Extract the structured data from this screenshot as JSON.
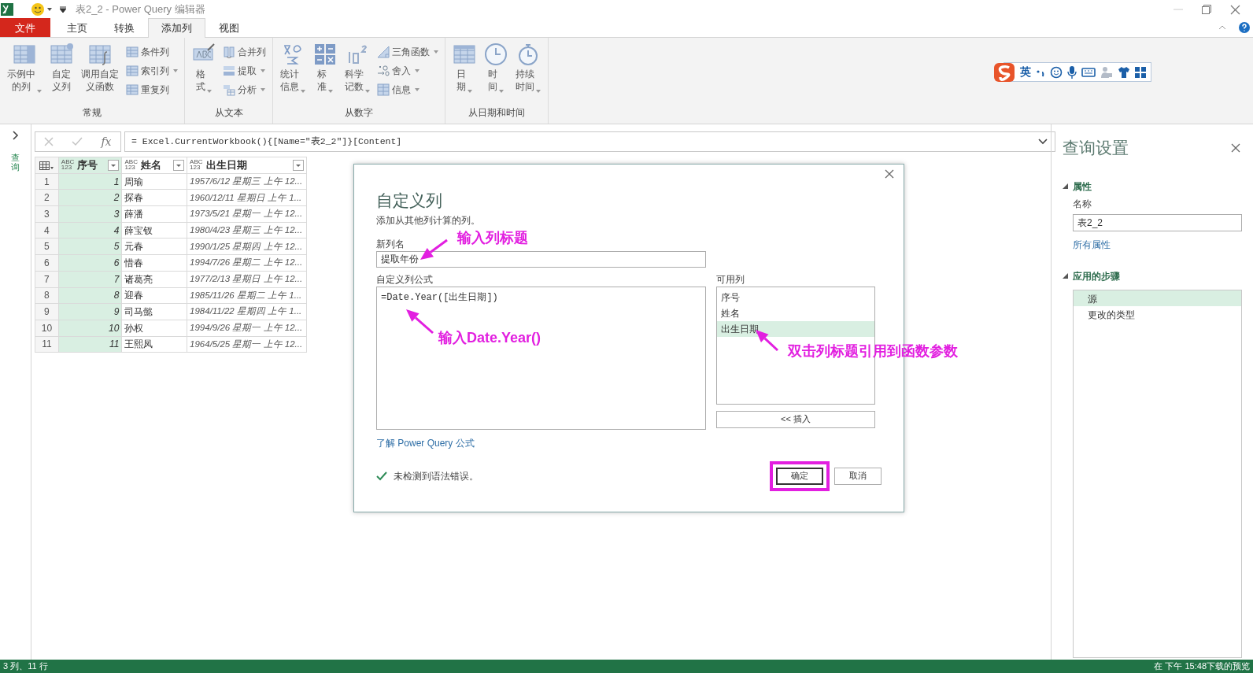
{
  "window": {
    "title": "表2_2 - Power Query 编辑器"
  },
  "menu_tabs": [
    {
      "label": "文件",
      "kind": "file",
      "selected": false
    },
    {
      "label": "主页",
      "kind": "tab",
      "selected": false
    },
    {
      "label": "转换",
      "kind": "tab",
      "selected": false
    },
    {
      "label": "添加列",
      "kind": "tab",
      "selected": true
    },
    {
      "label": "视图",
      "kind": "tab",
      "selected": false
    }
  ],
  "ribbon": {
    "groups": [
      {
        "label": "常规",
        "buttons": [
          {
            "label": "示例中的列",
            "kind": "large",
            "dropdown": true
          },
          {
            "label": "自定义列",
            "kind": "large",
            "dropdown": false
          },
          {
            "label": "调用自定义函数",
            "kind": "large",
            "dropdown": false
          },
          {
            "label": "条件列",
            "kind": "small",
            "dropdown": false
          },
          {
            "label": "索引列",
            "kind": "small",
            "dropdown": true
          },
          {
            "label": "重复列",
            "kind": "small",
            "dropdown": false
          }
        ]
      },
      {
        "label": "从文本",
        "buttons": [
          {
            "label": "格式",
            "kind": "large",
            "dropdown": true
          },
          {
            "label": "合并列",
            "kind": "small",
            "dropdown": false
          },
          {
            "label": "提取",
            "kind": "small",
            "dropdown": true
          },
          {
            "label": "分析",
            "kind": "small",
            "dropdown": true
          }
        ]
      },
      {
        "label": "从数字",
        "buttons": [
          {
            "label": "统计信息",
            "kind": "large",
            "dropdown": true
          },
          {
            "label": "标准",
            "kind": "large",
            "dropdown": true
          },
          {
            "label": "科学记数",
            "kind": "large",
            "dropdown": true
          },
          {
            "label": "三角函数",
            "kind": "small",
            "dropdown": true
          },
          {
            "label": "舍入",
            "kind": "small",
            "dropdown": true
          },
          {
            "label": "信息",
            "kind": "small",
            "dropdown": true
          }
        ]
      },
      {
        "label": "从日期和时间",
        "buttons": [
          {
            "label": "日期",
            "kind": "large",
            "dropdown": true
          },
          {
            "label": "时间",
            "kind": "large",
            "dropdown": true
          },
          {
            "label": "持续时间",
            "kind": "large",
            "dropdown": true
          }
        ]
      }
    ]
  },
  "ime_toolbar": {
    "mode": "英"
  },
  "queries_pane": {
    "label": "查询"
  },
  "formula_bar": {
    "fx": "fx",
    "formula": "= Excel.CurrentWorkbook(){[Name=\"表2_2\"]}[Content]"
  },
  "table": {
    "columns": [
      {
        "type": "ABC\n123",
        "name": "序号",
        "kind": "number",
        "selected": true
      },
      {
        "type": "ABC\n123",
        "name": "姓名",
        "kind": "text",
        "selected": false
      },
      {
        "type": "ABC\n123",
        "name": "出生日期",
        "kind": "datetime",
        "selected": false
      }
    ],
    "rows": [
      {
        "index": "1",
        "cells": [
          "1",
          "周瑜",
          "1957/6/12 星期三 上午 12..."
        ]
      },
      {
        "index": "2",
        "cells": [
          "2",
          "探春",
          "1960/12/11 星期日 上午 1..."
        ]
      },
      {
        "index": "3",
        "cells": [
          "3",
          "薛潘",
          "1973/5/21 星期一 上午 12..."
        ]
      },
      {
        "index": "4",
        "cells": [
          "4",
          "薛宝钗",
          "1980/4/23 星期三 上午 12..."
        ]
      },
      {
        "index": "5",
        "cells": [
          "5",
          "元春",
          "1990/1/25 星期四 上午 12..."
        ]
      },
      {
        "index": "6",
        "cells": [
          "6",
          "惜春",
          "1994/7/26 星期二 上午 12..."
        ]
      },
      {
        "index": "7",
        "cells": [
          "7",
          "诸葛亮",
          "1977/2/13 星期日 上午 12..."
        ]
      },
      {
        "index": "8",
        "cells": [
          "8",
          "迎春",
          "1985/11/26 星期二 上午 1..."
        ]
      },
      {
        "index": "9",
        "cells": [
          "9",
          "司马懿",
          "1984/11/22 星期四 上午 1..."
        ]
      },
      {
        "index": "10",
        "cells": [
          "10",
          "孙权",
          "1994/9/26 星期一 上午 12..."
        ]
      },
      {
        "index": "11",
        "cells": [
          "11",
          "王熙凤",
          "1964/5/25 星期一 上午 12..."
        ]
      }
    ]
  },
  "dialog": {
    "title": "自定义列",
    "description": "添加从其他列计算的列。",
    "new_name_label": "新列名",
    "new_name_value": "提取年份",
    "formula_label": "自定义列公式",
    "formula": "=Date.Year([出生日期])",
    "available_label": "可用列",
    "available_columns": [
      {
        "label": "序号",
        "selected": false
      },
      {
        "label": "姓名",
        "selected": false
      },
      {
        "label": "出生日期",
        "selected": true
      }
    ],
    "insert_button": "<< 插入",
    "learn_link": "了解 Power Query 公式",
    "status": "未检测到语法错误。",
    "ok_button": "确定",
    "ok_highlighted": true,
    "cancel_button": "取消"
  },
  "annotations": [
    {
      "text": "输入列标题"
    },
    {
      "text": "输入Date.Year()"
    },
    {
      "text": "双击列标题引用到函数参数"
    }
  ],
  "settings_pane": {
    "title": "查询设置",
    "properties": {
      "title": "属性",
      "expanded": true,
      "name_label": "名称",
      "name_value": "表2_2",
      "all_link": "所有属性"
    },
    "steps_section": {
      "title": "应用的步骤",
      "expanded": true
    },
    "steps": [
      {
        "label": "源",
        "selected": true
      },
      {
        "label": "更改的类型",
        "selected": false
      }
    ]
  },
  "status_bar": {
    "left": "3 列、11 行",
    "right": "在 下午 15:48下载的预览"
  }
}
